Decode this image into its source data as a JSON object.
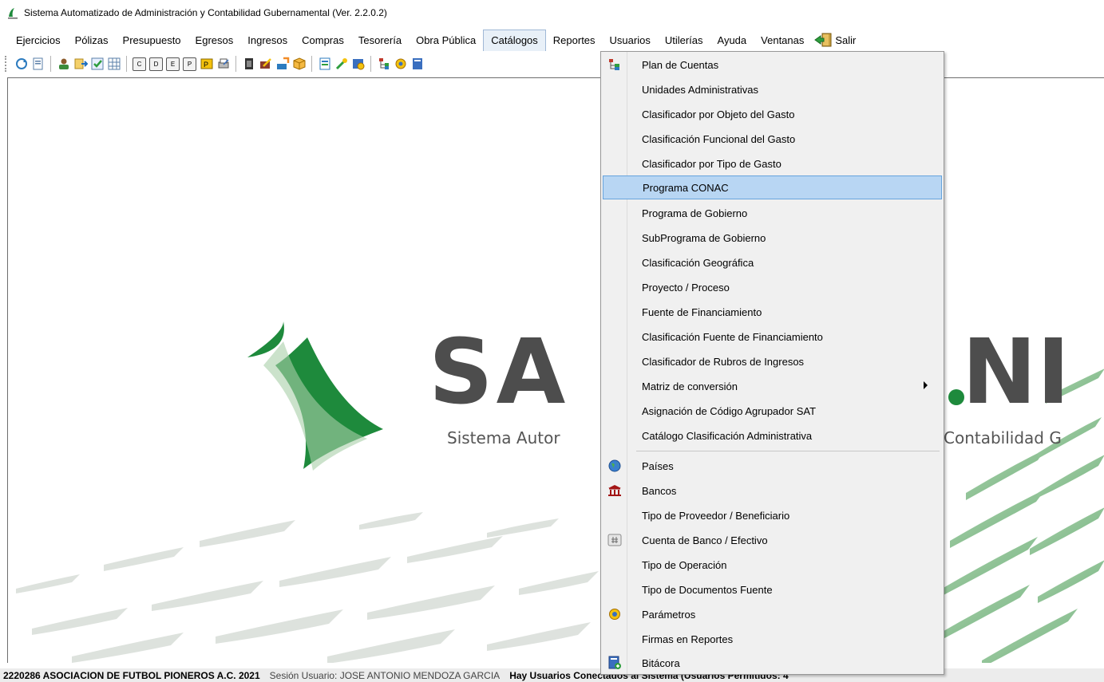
{
  "window": {
    "title": "Sistema Automatizado de Administración y Contabilidad Gubernamental  (Ver. 2.2.0.2)"
  },
  "menubar": {
    "items": [
      {
        "label": "Ejercicios"
      },
      {
        "label": "Pólizas"
      },
      {
        "label": "Presupuesto"
      },
      {
        "label": "Egresos"
      },
      {
        "label": "Ingresos"
      },
      {
        "label": "Compras"
      },
      {
        "label": "Tesorería"
      },
      {
        "label": "Obra Pública"
      },
      {
        "label": "Catálogos"
      },
      {
        "label": "Reportes"
      },
      {
        "label": "Usuarios"
      },
      {
        "label": "Utilerías"
      },
      {
        "label": "Ayuda"
      },
      {
        "label": "Ventanas"
      }
    ],
    "exit_label": "Salir",
    "active": "Catálogos"
  },
  "toolbar": {
    "letter_buttons": [
      "C",
      "D",
      "E",
      "P"
    ],
    "icons": [
      "refresh-icon",
      "document-icon",
      "users-icon",
      "import-icon",
      "check-list-icon",
      "grid-icon",
      "c-icon",
      "d-icon",
      "e-icon",
      "p-icon",
      "budget-icon",
      "print-icon",
      "clipboard-icon",
      "edit-icon",
      "transfer-icon",
      "box-icon",
      "catalog-icon",
      "tools-icon",
      "report-icon",
      "tree-icon",
      "settings-icon",
      "log-icon"
    ]
  },
  "logo": {
    "text_main": "SA",
    "text_right": "NI",
    "tagline_left": "Sistema Autor",
    "tagline_right": "Contabilidad G"
  },
  "catalog_menu": {
    "items": [
      {
        "label": "Plan de Cuentas",
        "icon": "tree-icon"
      },
      {
        "label": "Unidades Administrativas"
      },
      {
        "label": "Clasificador por Objeto del Gasto"
      },
      {
        "label": "Clasificación Funcional del Gasto"
      },
      {
        "label": "Clasificador por Tipo de Gasto"
      },
      {
        "label": "Programa CONAC",
        "selected": true
      },
      {
        "label": "Programa de Gobierno"
      },
      {
        "label": "SubPrograma de Gobierno"
      },
      {
        "label": "Clasificación Geográfica"
      },
      {
        "label": "Proyecto / Proceso"
      },
      {
        "label": "Fuente de Financiamiento"
      },
      {
        "label": "Clasificación Fuente de Financiamiento"
      },
      {
        "label": "Clasificador de Rubros de Ingresos"
      },
      {
        "label": "Matriz de conversión",
        "submenu": true
      },
      {
        "label": "Asignación de Código Agrupador SAT"
      },
      {
        "label": "Catálogo Clasificación Administrativa"
      },
      {
        "label": "Países",
        "icon": "globe-icon"
      },
      {
        "label": "Bancos",
        "icon": "bank-icon"
      },
      {
        "label": "Tipo de Proveedor / Beneficiario"
      },
      {
        "label": "Cuenta de Banco / Efectivo",
        "icon": "hash-icon"
      },
      {
        "label": "Tipo de Operación"
      },
      {
        "label": "Tipo de Documentos Fuente"
      },
      {
        "label": "Parámetros",
        "icon": "settings-icon"
      },
      {
        "label": "Firmas en Reportes"
      },
      {
        "label": "Bitácora",
        "icon": "log-icon"
      }
    ]
  },
  "statusbar": {
    "company": "2220286 ASOCIACION DE FUTBOL PIONEROS A.C.  2021",
    "user": "Sesión Usuario: JOSE ANTONIO MENDOZA GARCIA",
    "message": "Hay Usuarios Conectados al Sistema    (Usuarios Permitidos: 4"
  },
  "colors": {
    "brand_green": "#1e8a3c",
    "logo_gray": "#4d4d4d",
    "selection": "#b8d6f3",
    "selection_border": "#66a3dc"
  }
}
